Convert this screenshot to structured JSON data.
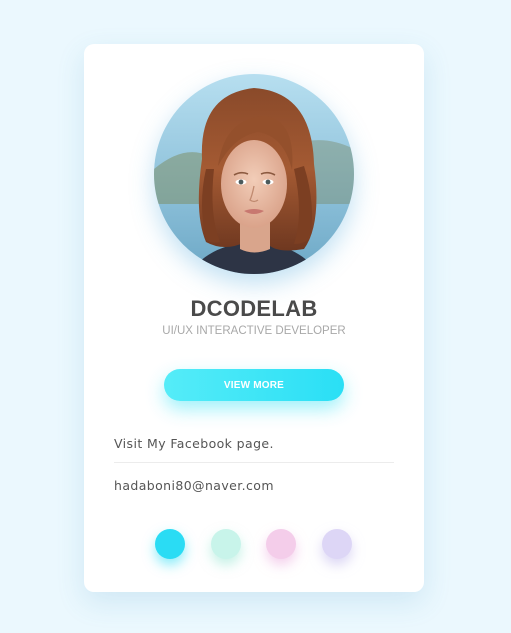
{
  "profile": {
    "name": "DCODELAB",
    "role": "UI/UX INTERACTIVE DEVELOPER"
  },
  "actions": {
    "view_more_label": "VIEW MORE"
  },
  "links": {
    "facebook": "Visit My Facebook page.",
    "email": "hadaboni80@naver.com"
  },
  "theme_dots": [
    {
      "name": "cyan",
      "color": "#2adcf4"
    },
    {
      "name": "mint",
      "color": "#c8f4ea"
    },
    {
      "name": "pink",
      "color": "#f4cdea"
    },
    {
      "name": "lavender",
      "color": "#ddd6f6"
    }
  ],
  "colors": {
    "background": "#ebf8fe",
    "accent": "#2adff5",
    "card": "#ffffff"
  }
}
